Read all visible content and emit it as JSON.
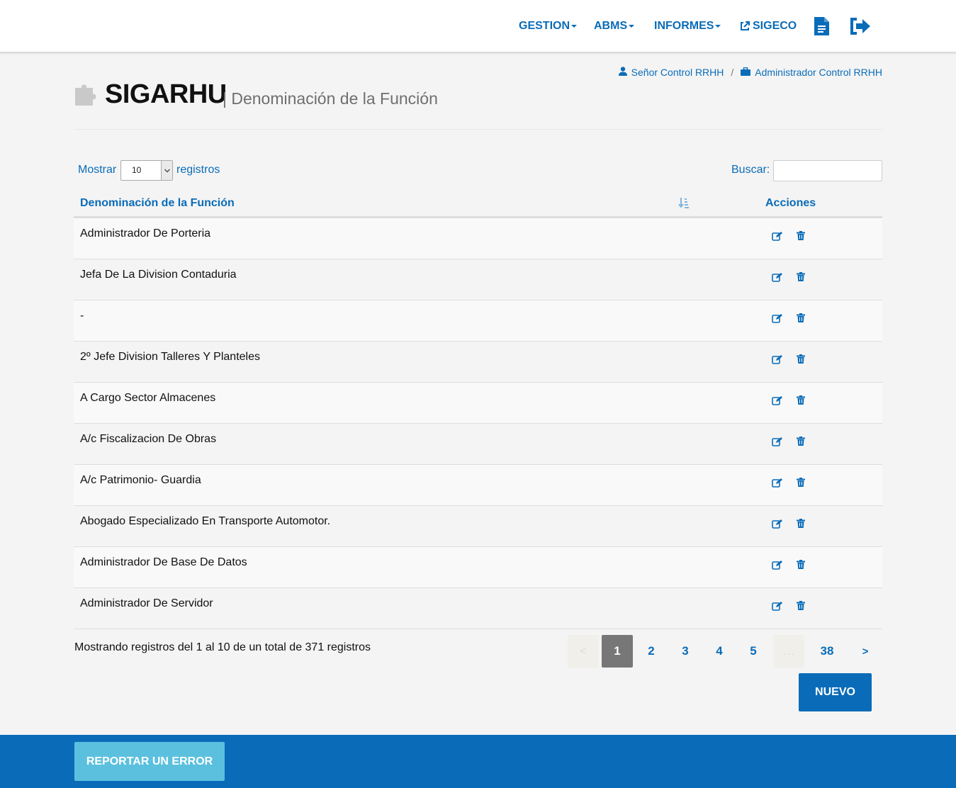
{
  "nav": {
    "gestion": "GESTION",
    "abms": "ABMS",
    "informes": "INFORMES",
    "sigeco": "SIGECO"
  },
  "breadcrumb": {
    "user": "Señor Control RRHH",
    "separator": "/",
    "role": "Administrador Control RRHH"
  },
  "header": {
    "title": "SIGARHU",
    "subtitle": "| Denominación de la Función"
  },
  "controls": {
    "show_label": "Mostrar",
    "show_value": "10",
    "records_label": "registros",
    "search_label": "Buscar:",
    "search_value": ""
  },
  "table": {
    "columns": [
      "Denominación de la Función",
      "Acciones"
    ],
    "rows": [
      "Administrador De Porteria",
      "Jefa De La Division Contaduria",
      "-",
      "2º Jefe Division Talleres Y Planteles",
      "A Cargo Sector Almacenes",
      "A/c Fiscalizacion De Obras",
      "A/c Patrimonio- Guardia",
      "Abogado Especializado En Transporte Automotor.",
      "Administrador De Base De Datos",
      "Administrador De Servidor"
    ]
  },
  "info": "Mostrando registros del 1 al 10 de un total de 371 registros",
  "pagination": {
    "prev": "<",
    "pages": [
      "1",
      "2",
      "3",
      "4",
      "5"
    ],
    "ellipsis": "…",
    "last": "38",
    "next": ">",
    "current": "1"
  },
  "buttons": {
    "nuevo": "NUEVO",
    "report": "REPORTAR UN ERROR"
  },
  "colors": {
    "primary": "#0a6cb8",
    "report": "#5bc0de",
    "active_page": "#777777"
  }
}
